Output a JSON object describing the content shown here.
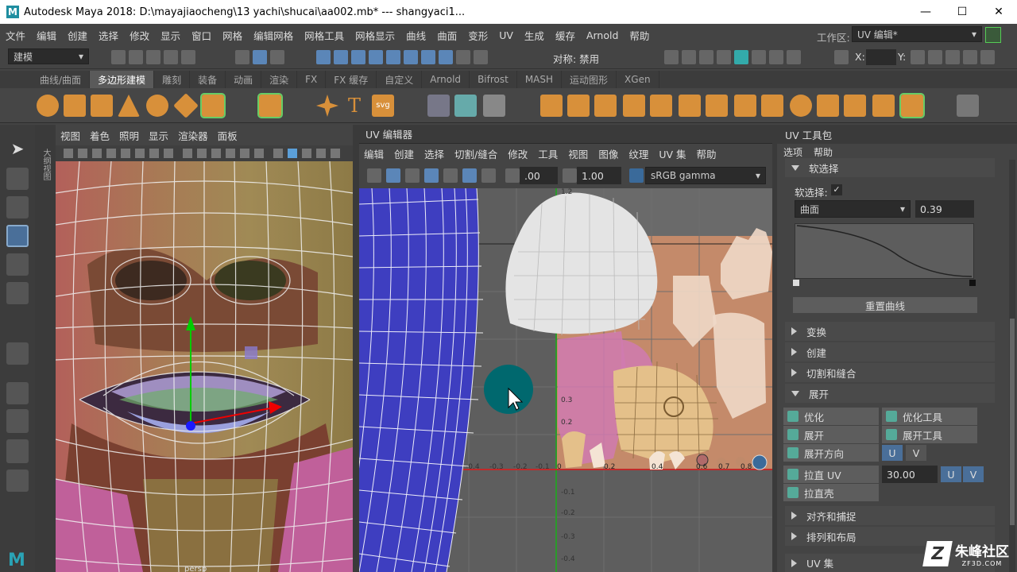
{
  "window": {
    "title": "Autodesk Maya 2018: D:\\mayajiaocheng\\13 yachi\\shucai\\aa002.mb*   ---   shangyaci1...",
    "logo": "M",
    "min": "—",
    "max": "☐",
    "close": "✕"
  },
  "menubar": {
    "items": [
      "文件",
      "编辑",
      "创建",
      "选择",
      "修改",
      "显示",
      "窗口",
      "网格",
      "编辑网格",
      "网格工具",
      "网格显示",
      "曲线",
      "曲面",
      "变形",
      "UV",
      "生成",
      "缓存",
      "Arnold",
      "帮助"
    ],
    "workspace_label": "工作区:",
    "workspace_value": "UV 编辑*"
  },
  "toolbar": {
    "mode": "建模",
    "symmetry": "对称: 禁用",
    "x_label": "X:",
    "y_label": "Y:"
  },
  "shelf": {
    "tabs": [
      "曲线/曲面",
      "多边形建模",
      "雕刻",
      "装备",
      "动画",
      "渲染",
      "FX",
      "FX 缓存",
      "自定义",
      "Arnold",
      "Bifrost",
      "MASH",
      "运动图形",
      "XGen"
    ],
    "active": "多边形建模",
    "svg_label": "svg"
  },
  "viewport": {
    "menu": [
      "视图",
      "着色",
      "照明",
      "显示",
      "渲染器",
      "面板"
    ],
    "side_label": "大纲视图",
    "camera": "persp"
  },
  "uv_editor": {
    "title": "UV 编辑器",
    "menu": [
      "编辑",
      "创建",
      "选择",
      "切割/缝合",
      "修改",
      "工具",
      "视图",
      "图像",
      "纹理",
      "UV 集",
      "帮助"
    ],
    "exposure": ".00",
    "gamma": "1.00",
    "colorspace": "sRGB gamma",
    "axis_labels": {
      "v1_2": "1.2",
      "v0_3": "0.3",
      "v0_2": "0.2",
      "v_0_1": "-0.1",
      "v_0_2": "-0.2",
      "v_0_3": "-0.3",
      "v_0_4": "-0.4",
      "u_0_4": "-0.4",
      "u_0_3": "-0.3",
      "u_0_2": "-0.2",
      "u_0_1": "-0.1",
      "u0": "0",
      "u0_2": "0.2",
      "u0_4": "0.4",
      "u0_6": "0.6",
      "u0_7": "0.7",
      "u0_8": "0.8"
    }
  },
  "uv_toolkit": {
    "title": "UV 工具包",
    "menu": [
      "选项",
      "帮助"
    ],
    "soft_select": {
      "header": "软选择",
      "label": "软选择:",
      "checked": true,
      "falloff": "曲面",
      "value": "0.39",
      "reset": "重置曲线"
    },
    "sections": [
      "变换",
      "创建",
      "切割和缝合"
    ],
    "unfold": {
      "header": "展开",
      "optimize": "优化",
      "optimize_tool": "优化工具",
      "unfold": "展开",
      "unfold_tool": "展开工具",
      "unfold_dir": "展开方向",
      "u": "U",
      "v": "V",
      "straighten": "拉直 UV",
      "straighten_value": "30.00",
      "straighten_shell": "拉直壳"
    },
    "more_sections": [
      "对齐和捕捉",
      "排列和布局",
      "UV 集"
    ]
  },
  "watermark": {
    "brand": "朱峰社区",
    "site": "ZF3D.COM"
  }
}
